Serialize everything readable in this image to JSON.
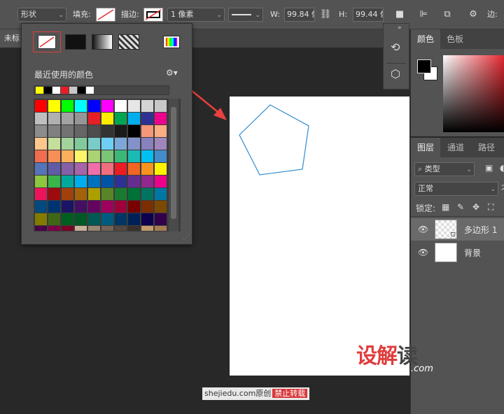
{
  "options_bar": {
    "mode_value": "形状",
    "fill_label": "填充:",
    "stroke_label": "描边:",
    "stroke_width_value": "1 像素",
    "width_label": "W:",
    "width_value": "99.84 像",
    "height_label": "H:",
    "height_value": "99.44 像",
    "edge_label": "边:"
  },
  "document": {
    "tab_title": "未标"
  },
  "swatch_popup": {
    "recent_title": "最近使用的颜色",
    "recent_colors": [
      "#ffff00",
      "#000000",
      "#ffffff",
      "#ed1c24",
      "#c8c8c8",
      "#000000",
      "#ffffff"
    ],
    "swatch_colors": [
      "#ff0000",
      "#ffff00",
      "#00ff00",
      "#00ffff",
      "#0000ff",
      "#ff00ff",
      "#ffffff",
      "#e6e6e6",
      "#d4d4d4",
      "#c8c8c8",
      "#bfbfbf",
      "#b0b0b0",
      "#a3a3a3",
      "#969696",
      "#e61e28",
      "#ffec00",
      "#00a651",
      "#00aeef",
      "#2e3192",
      "#ec008c",
      "#8c8c8c",
      "#808080",
      "#737373",
      "#666666",
      "#4d4d4d",
      "#333333",
      "#1a1a1a",
      "#000000",
      "#f7977a",
      "#fbad82",
      "#fdc68c",
      "#c4df9b",
      "#a3d39c",
      "#82ca9c",
      "#7accc8",
      "#6dcff6",
      "#7da7d9",
      "#8393ca",
      "#8781bd",
      "#a186be",
      "#f26c4f",
      "#f68e56",
      "#fbaf5d",
      "#fff568",
      "#acd373",
      "#7cc576",
      "#3bb878",
      "#1abbb4",
      "#00bff3",
      "#438ccb",
      "#5574b9",
      "#605ca8",
      "#8560a8",
      "#a864a8",
      "#f06eaa",
      "#f26d7d",
      "#ed1c24",
      "#f26522",
      "#f7941d",
      "#fff200",
      "#8dc63f",
      "#39b54a",
      "#00a99d",
      "#00adef",
      "#0072bc",
      "#0054a6",
      "#2e3192",
      "#662d91",
      "#92278f",
      "#ec008c",
      "#ed145b",
      "#9e0b0f",
      "#a0410d",
      "#a36209",
      "#aba000",
      "#598527",
      "#1a7b30",
      "#007236",
      "#007460",
      "#0076a3",
      "#004a80",
      "#003471",
      "#1b1464",
      "#440e62",
      "#630460",
      "#9e005d",
      "#9e0039",
      "#790000",
      "#7b2e00",
      "#7d4900",
      "#827b00",
      "#406618",
      "#005e20",
      "#005826",
      "#005952",
      "#005b7f",
      "#003663",
      "#002157",
      "#0d004c",
      "#32004b",
      "#4b0049",
      "#7b0046",
      "#7a0026",
      "#c7b299",
      "#998675",
      "#736357",
      "#534741",
      "#37302d",
      "#c69c6d",
      "#a67c52",
      "#8c6239",
      "#754c24",
      "#603913",
      "#42210b"
    ]
  },
  "color_panel": {
    "tabs": [
      "颜色",
      "色板"
    ],
    "foreground": "#000000",
    "background": "#ffffff"
  },
  "layers_panel": {
    "tabs": [
      "图层",
      "通道",
      "路径"
    ],
    "filter_value": "类型",
    "blend_mode_value": "正常",
    "lock_label": "锁定:",
    "layers": [
      {
        "name": "多边形 1",
        "selected": true
      },
      {
        "name": "背景",
        "selected": false
      }
    ]
  },
  "watermark": {
    "logo_red": "设解",
    "logo_gray": "读",
    "logo_suffix": ".com",
    "site_text": "shejiedu.com原创",
    "notice": "禁止转载"
  }
}
